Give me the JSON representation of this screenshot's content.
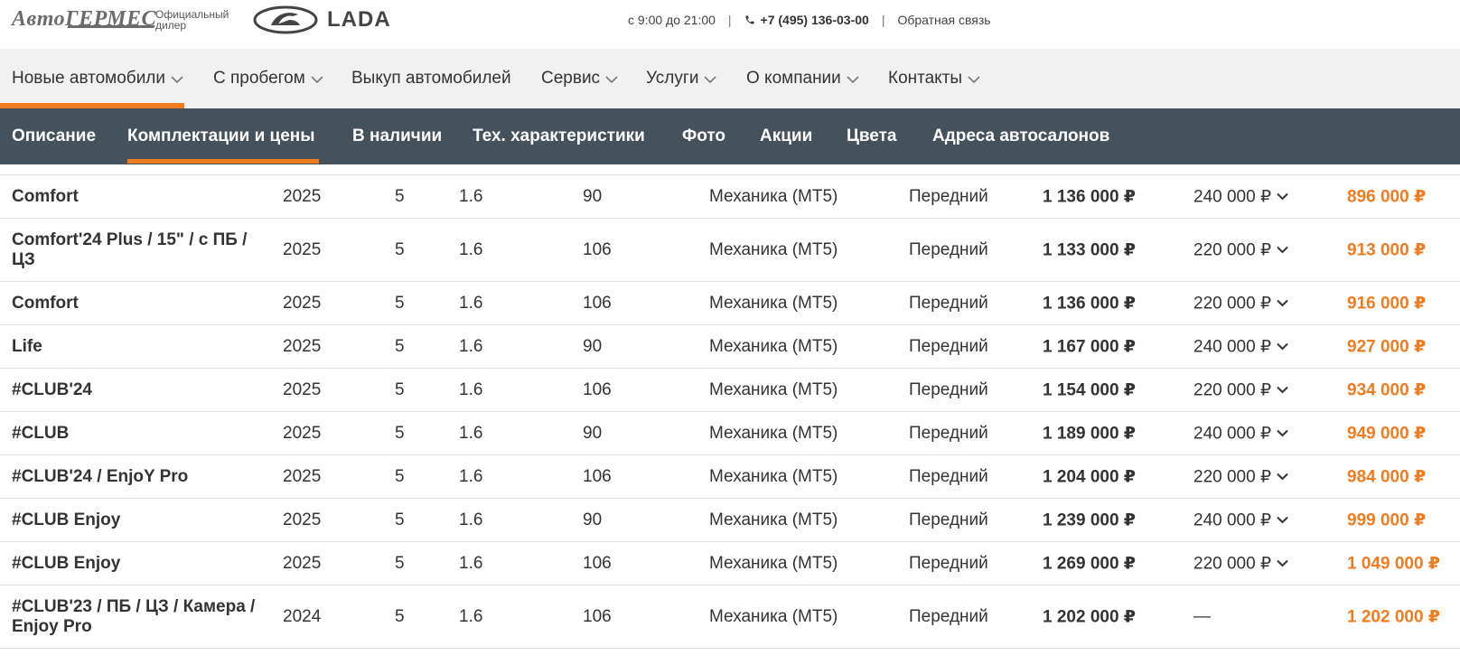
{
  "header": {
    "brand": "АвтоГЕРМЕС",
    "dealer_line1": "Официальный",
    "dealer_line2": "дилер",
    "lada_text": "LADA",
    "hours": "с 9:00 до 21:00",
    "separator": "|",
    "phone": "+7 (495) 136-03-00",
    "feedback": "Обратная связь"
  },
  "mainnav": {
    "items": [
      {
        "label": "Новые автомобили",
        "chevron": true
      },
      {
        "label": "С пробегом",
        "chevron": true
      },
      {
        "label": "Выкуп автомобилей",
        "chevron": false
      },
      {
        "label": "Сервис",
        "chevron": true
      },
      {
        "label": "Услуги",
        "chevron": true
      },
      {
        "label": "О компании",
        "chevron": true
      },
      {
        "label": "Контакты",
        "chevron": true
      }
    ]
  },
  "subnav": {
    "tabs": [
      "Описание",
      "Комплектации и цены",
      "В наличии",
      "Тех. характеристики",
      "Фото",
      "Акции",
      "Цвета",
      "Адреса автосалонов"
    ],
    "active_index": 1
  },
  "colors": {
    "accent": "#f07c1f",
    "subnav_bg": "#46525b",
    "mainnav_bg": "#f1f1f1"
  },
  "table": {
    "rows": [
      {
        "name": "Comfort",
        "year": "2025",
        "doors": "5",
        "engine": "1.6",
        "power": "90",
        "gearbox": "Механика (MT5)",
        "drive": "Передний",
        "price": "1 136 000 ₽",
        "discount": "240 000 ₽",
        "final": "896 000 ₽"
      },
      {
        "name": "Comfort'24 Plus / 15\" / с ПБ / ЦЗ",
        "year": "2025",
        "doors": "5",
        "engine": "1.6",
        "power": "106",
        "gearbox": "Механика (MT5)",
        "drive": "Передний",
        "price": "1 133 000 ₽",
        "discount": "220 000 ₽",
        "final": "913 000 ₽"
      },
      {
        "name": "Comfort",
        "year": "2025",
        "doors": "5",
        "engine": "1.6",
        "power": "106",
        "gearbox": "Механика (MT5)",
        "drive": "Передний",
        "price": "1 136 000 ₽",
        "discount": "220 000 ₽",
        "final": "916 000 ₽"
      },
      {
        "name": "Life",
        "year": "2025",
        "doors": "5",
        "engine": "1.6",
        "power": "90",
        "gearbox": "Механика (MT5)",
        "drive": "Передний",
        "price": "1 167 000 ₽",
        "discount": "240 000 ₽",
        "final": "927 000 ₽"
      },
      {
        "name": "#CLUB'24",
        "year": "2025",
        "doors": "5",
        "engine": "1.6",
        "power": "106",
        "gearbox": "Механика (MT5)",
        "drive": "Передний",
        "price": "1 154 000 ₽",
        "discount": "220 000 ₽",
        "final": "934 000 ₽"
      },
      {
        "name": "#CLUB",
        "year": "2025",
        "doors": "5",
        "engine": "1.6",
        "power": "90",
        "gearbox": "Механика (MT5)",
        "drive": "Передний",
        "price": "1 189 000 ₽",
        "discount": "240 000 ₽",
        "final": "949 000 ₽"
      },
      {
        "name": "#CLUB'24 / EnjoY Pro",
        "year": "2025",
        "doors": "5",
        "engine": "1.6",
        "power": "106",
        "gearbox": "Механика (MT5)",
        "drive": "Передний",
        "price": "1 204 000 ₽",
        "discount": "220 000 ₽",
        "final": "984 000 ₽"
      },
      {
        "name": "#CLUB Enjoy",
        "year": "2025",
        "doors": "5",
        "engine": "1.6",
        "power": "90",
        "gearbox": "Механика (MT5)",
        "drive": "Передний",
        "price": "1 239 000 ₽",
        "discount": "240 000 ₽",
        "final": "999 000 ₽"
      },
      {
        "name": "#CLUB Enjoy",
        "year": "2025",
        "doors": "5",
        "engine": "1.6",
        "power": "106",
        "gearbox": "Механика (MT5)",
        "drive": "Передний",
        "price": "1 269 000 ₽",
        "discount": "220 000 ₽",
        "final": "1 049 000 ₽"
      },
      {
        "name": "#CLUB'23 / ПБ / ЦЗ / Камера / Enjoy Pro",
        "year": "2024",
        "doors": "5",
        "engine": "1.6",
        "power": "106",
        "gearbox": "Механика (MT5)",
        "drive": "Передний",
        "price": "1 202 000 ₽",
        "discount": "—",
        "final": "1 202 000 ₽"
      }
    ]
  }
}
